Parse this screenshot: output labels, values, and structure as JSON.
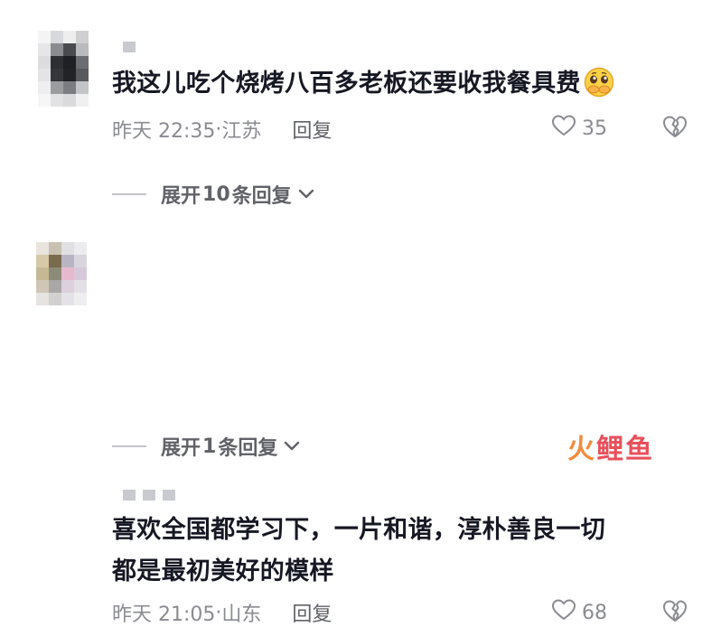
{
  "comments": [
    {
      "text_line1": "我这儿吃个烧烤八百多老板还要收我餐具费",
      "text_line2": "",
      "emoji": "pleading-face-emoji",
      "time": "昨天 22:35",
      "sep": "·",
      "location": "江苏",
      "reply_label": "回复",
      "likes": "35",
      "expand_label": "展开10条回复",
      "expand_prefix": "展开",
      "expand_count": "10",
      "expand_suffix": "条回复"
    },
    {
      "text_line1": "喜欢全国都学习下，一片和谐，淳朴善良一切",
      "text_line2": "都是最初美好的模样",
      "time": "昨天 21:05",
      "sep": "·",
      "location": "山东",
      "reply_label": "回复",
      "likes": "68",
      "expand_label": "展开1条回复",
      "expand_prefix": "展开",
      "expand_count": "1",
      "expand_suffix": "条回复"
    }
  ],
  "watermark": {
    "text": "火鲤鱼",
    "colors": [
      "#f28b3c",
      "#e8505b",
      "#e8505b"
    ]
  },
  "colors": {
    "text_primary": "#161823",
    "text_secondary": "#8a8b91",
    "accent_watermark": "#e8505b"
  }
}
